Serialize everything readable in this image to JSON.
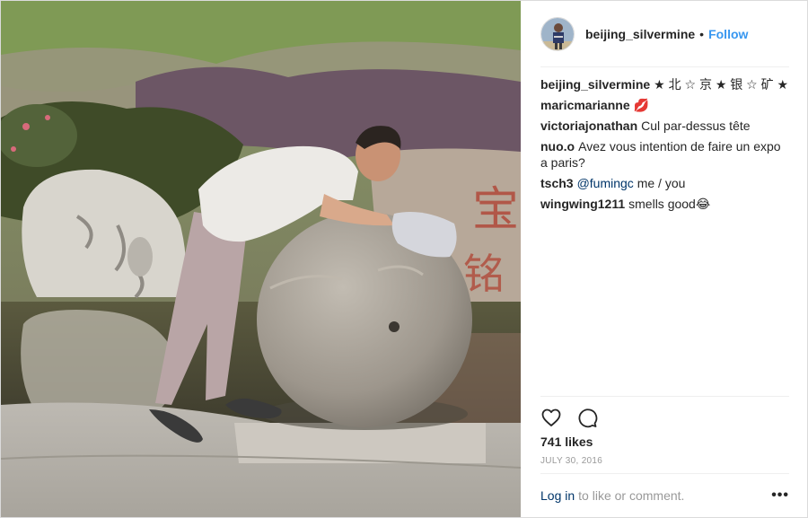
{
  "post": {
    "username": "beijing_silvermine",
    "separator": "•",
    "follow_label": "Follow",
    "likes": "741 likes",
    "date": "JULY 30, 2016",
    "icons": {
      "like": "heart-icon",
      "comment": "comment-bubble-icon",
      "more": "more-options-icon"
    }
  },
  "comments": [
    {
      "user": "beijing_silvermine",
      "text": "★ 北 ☆ 京 ★ 银 ☆ 矿 ★"
    },
    {
      "user": "maricmarianne",
      "text": "💋"
    },
    {
      "user": "victoriajonathan",
      "text": "Cul par-dessus tête"
    },
    {
      "user": "nuo.o",
      "text": "Avez vous intention de faire un expo a paris?"
    },
    {
      "user": "tsch3",
      "mention": "@fumingc",
      "text": " me / you"
    },
    {
      "user": "wingwing1211",
      "text": "smells good😂"
    }
  ],
  "footer": {
    "login_label": "Log in",
    "rest_label": "to like or comment.",
    "more_label": "•••"
  },
  "colors": {
    "link_blue": "#3897f0",
    "mention_blue": "#003569",
    "muted_gray": "#999999",
    "border": "#efefef"
  }
}
